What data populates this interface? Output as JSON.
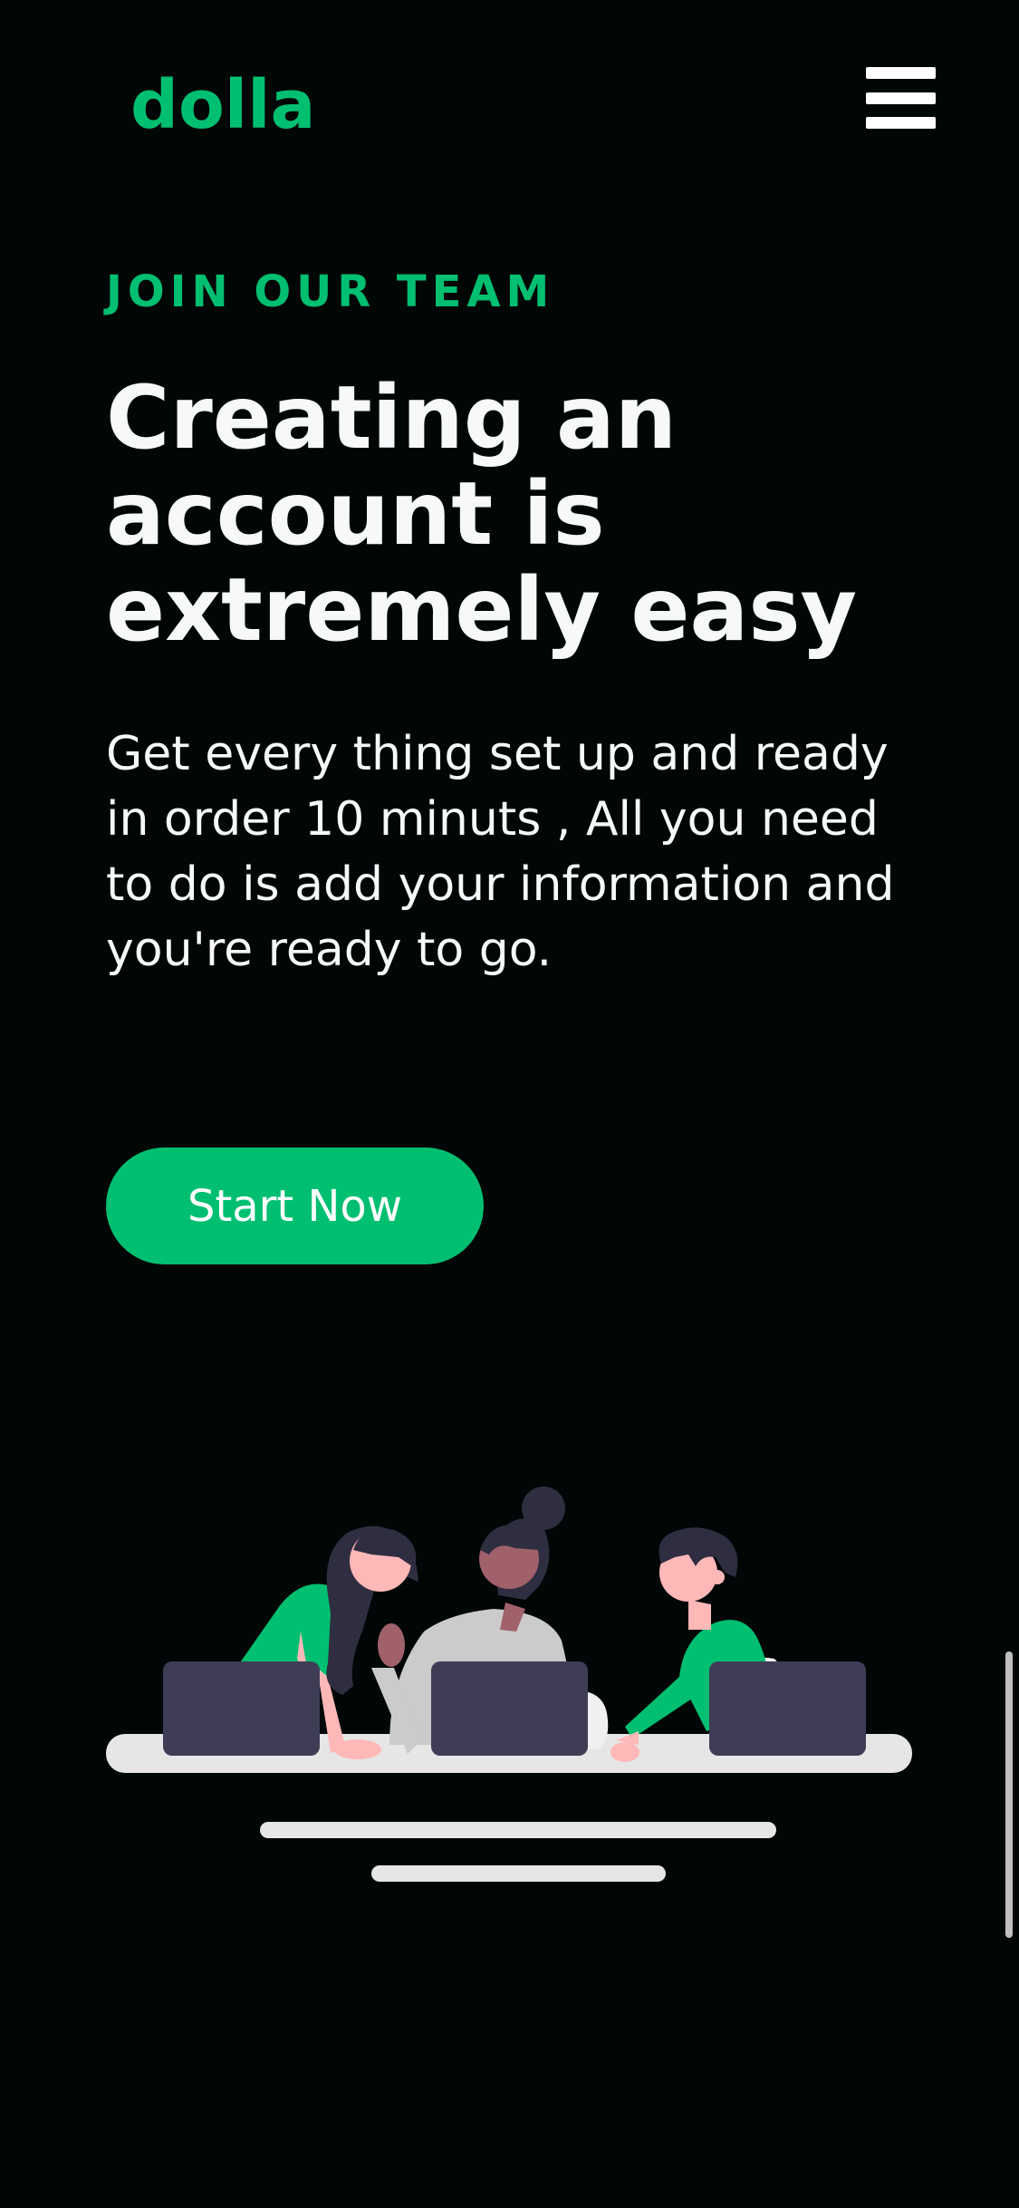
{
  "nav": {
    "logo": "dolla",
    "menu_icon": "hamburger-menu-icon"
  },
  "hero": {
    "topline": "JOIN OUR TEAM",
    "heading": "Creating an account is extremely easy",
    "description": "Get every thing set up and ready in order 10 minuts , All you need to do is add your information and you're ready to go.",
    "button_label": "Start Now"
  },
  "illustration": {
    "name": "team-working-on-laptops",
    "colors": {
      "accent": "#01bf71",
      "laptop": "#3f3d56",
      "desk": "#e6e6e6",
      "skin_light": "#ffb8b8",
      "skin_dark": "#a0616a",
      "hair": "#2f2e41",
      "shirt_gray": "#cbcbcb"
    }
  },
  "colors": {
    "background": "#010606",
    "brand": "#01bf71",
    "text": "#f7f8fa"
  }
}
